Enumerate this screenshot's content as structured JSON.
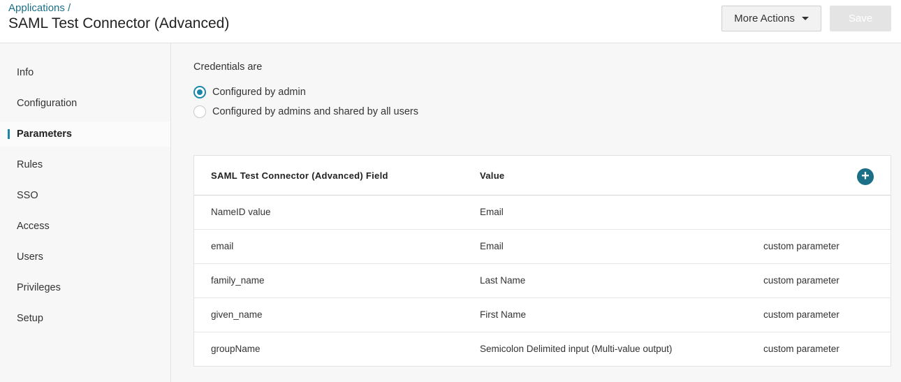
{
  "header": {
    "breadcrumb": "Applications /",
    "title": "SAML Test Connector (Advanced)",
    "more_actions_label": "More Actions",
    "save_label": "Save"
  },
  "sidebar": {
    "items": [
      {
        "label": "Info"
      },
      {
        "label": "Configuration"
      },
      {
        "label": "Parameters",
        "active": true
      },
      {
        "label": "Rules"
      },
      {
        "label": "SSO"
      },
      {
        "label": "Access"
      },
      {
        "label": "Users"
      },
      {
        "label": "Privileges"
      },
      {
        "label": "Setup"
      }
    ]
  },
  "credentials": {
    "label": "Credentials are",
    "options": [
      {
        "label": "Configured by admin",
        "selected": true
      },
      {
        "label": "Configured by admins and shared by all users",
        "selected": false
      }
    ]
  },
  "table": {
    "columns": [
      "SAML Test Connector (Advanced) Field",
      "Value"
    ],
    "add_icon": "plus-circle-icon",
    "rows": [
      {
        "field": "NameID value",
        "value": "Email",
        "note": ""
      },
      {
        "field": "email",
        "value": "Email",
        "note": "custom parameter"
      },
      {
        "field": "family_name",
        "value": "Last Name",
        "note": "custom parameter"
      },
      {
        "field": "given_name",
        "value": "First Name",
        "note": "custom parameter"
      },
      {
        "field": "groupName",
        "value": "Semicolon Delimited input (Multi-value output)",
        "note": "custom parameter"
      }
    ]
  },
  "colors": {
    "accent": "#1b87a8",
    "link": "#1b6f86"
  }
}
